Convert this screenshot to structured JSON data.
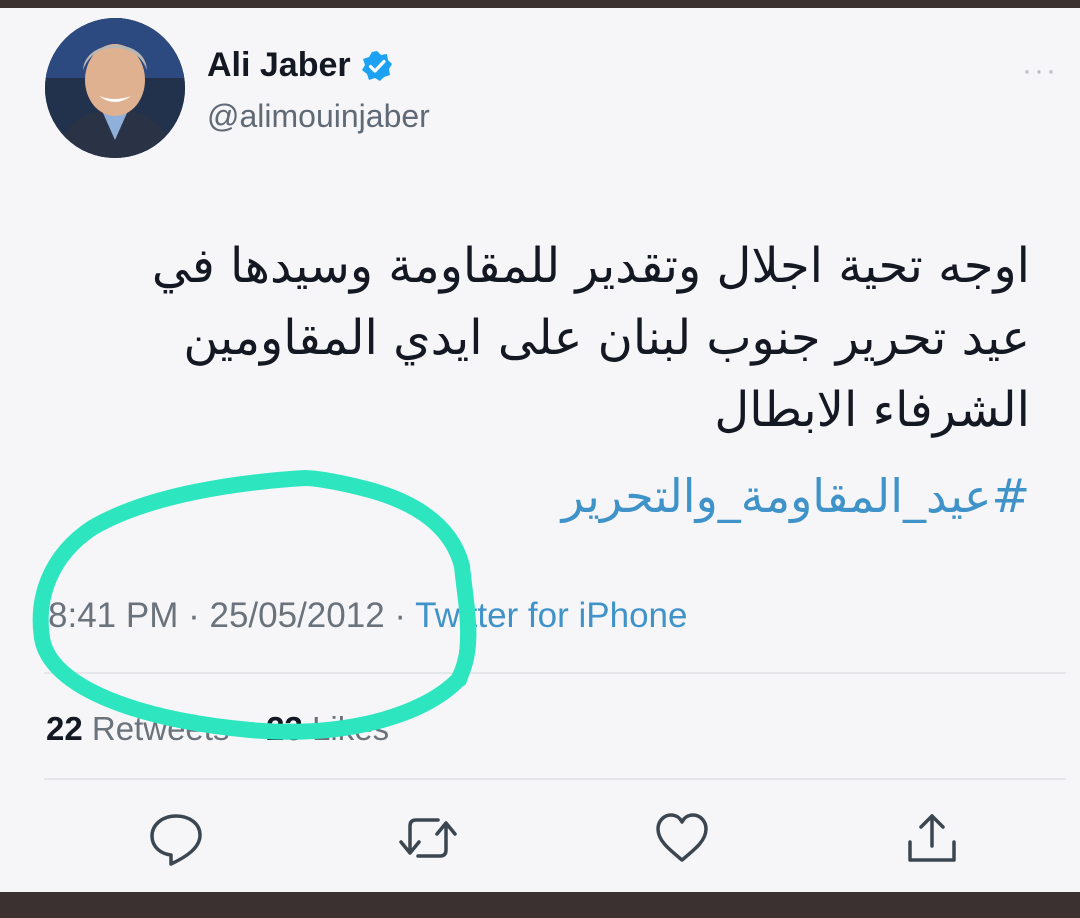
{
  "author": {
    "name": "Ali Jaber",
    "handle": "@alimouinjaber",
    "verified": true
  },
  "more_label": "···",
  "tweet": {
    "text_lines": [
      "اوجه تحية اجلال وتقدير للمقاومة وسيدها في",
      "عيد تحرير جنوب لبنان على ايدي المقاومين",
      "الشرفاء الابطال"
    ],
    "hashtag": "#عيد_المقاومة_والتحرير",
    "time": "8:41 PM",
    "separator": "·",
    "date": "25/05/2012",
    "source": "Twitter for iPhone"
  },
  "stats": {
    "retweets_count": "22",
    "retweets_label": "Retweets",
    "likes_count": "23",
    "likes_label": "Likes"
  },
  "actions": [
    "reply-icon",
    "retweet-icon",
    "like-icon",
    "share-icon"
  ],
  "colors": {
    "link": "#3f93c8",
    "verified": "#1da1f2",
    "annotation_marker": "#2de6c0",
    "frame": "#3b3130"
  }
}
